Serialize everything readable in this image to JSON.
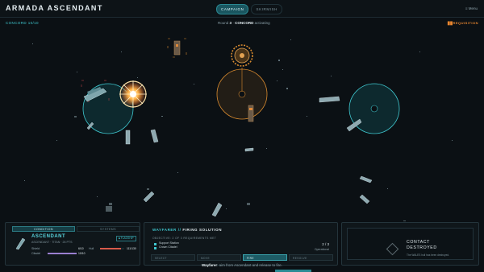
{
  "header": {
    "title": "ARMADA ASCENDANT",
    "modes": [
      "CAMPAIGN",
      "SKIRMISH"
    ],
    "active_mode": "CAMPAIGN",
    "menu_label": "≡ Menu"
  },
  "status": {
    "concord": "CONCORD 10/10",
    "round_prefix": "Round",
    "round_num": "3",
    "round_sep": "·",
    "faction": "CONCORD",
    "phase": "activating",
    "right_label": "██REQUISITION"
  },
  "condition_panel": {
    "tabs": [
      "CONDITION",
      "SYSTEMS"
    ],
    "active_tab": "CONDITION",
    "ship_name": "ASCENDANT",
    "ship_sub": "ASCENDANT · TITAN · 26 PTS",
    "badge": "■ FLAGSHIP",
    "stats": [
      {
        "label": "Shield",
        "value": "6/10",
        "fill": 0.6
      },
      {
        "label": "Hull",
        "value": "111/130",
        "fill": 0.85
      },
      {
        "label": "Citadel",
        "value": "10/10",
        "fill": 1.0
      }
    ]
  },
  "firing_panel": {
    "actor": "WAYFARER",
    "separator": "//",
    "mode": "FIRING SOLUTION",
    "objective": "OBJECTIVE: 2 OF 3 REQUIREMENTS MET",
    "objectives": [
      "Support Station",
      "Crown Citadel"
    ],
    "count": "2 / 3",
    "count_sub": "Operational",
    "actions": [
      "SELECT",
      "MOVE",
      "FIRE",
      "RESOLVE"
    ],
    "active_action": "FIRE"
  },
  "contact_panel": {
    "title_line1": "CONTACT",
    "title_line2": "DESTROYED",
    "desc": "The WALES hull has been destroyed."
  },
  "footer": {
    "actor": "Wayfarer",
    "instruction": ": aim from Ascendant and release to fire."
  },
  "colors": {
    "accent": "#3fc7cf",
    "enemy": "#d88a2f",
    "alert": "#e9862f",
    "background": "#0b1014"
  }
}
